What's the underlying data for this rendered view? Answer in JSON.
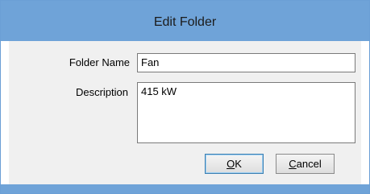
{
  "dialog": {
    "title": "Edit Folder"
  },
  "form": {
    "folder_name_label": "Folder Name",
    "folder_name_value": "Fan",
    "description_label": "Description",
    "description_value": "415 kW"
  },
  "buttons": {
    "ok_mnemonic": "O",
    "ok_rest": "K",
    "cancel_mnemonic": "C",
    "cancel_rest": "ancel"
  },
  "colors": {
    "titlebar": "#6fa3d8",
    "client_background": "#f0f0f0",
    "field_border": "#7a7a7a"
  }
}
